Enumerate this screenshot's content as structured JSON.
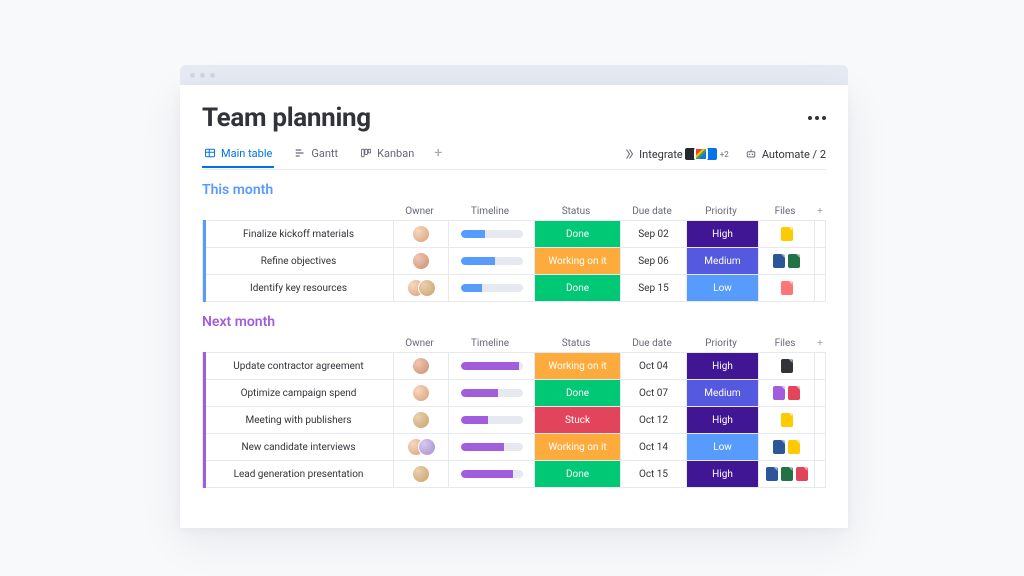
{
  "window": {
    "title": "Team planning"
  },
  "tabs": [
    {
      "label": "Main table",
      "icon": "table-icon",
      "active": true
    },
    {
      "label": "Gantt",
      "icon": "gantt-icon",
      "active": false
    },
    {
      "label": "Kanban",
      "icon": "kanban-icon",
      "active": false
    }
  ],
  "toolbar": {
    "integrate": {
      "label": "Integrate",
      "extra": "+2"
    },
    "automate": {
      "label": "Automate / 2"
    }
  },
  "columns": [
    "Owner",
    "Timeline",
    "Status",
    "Due date",
    "Priority",
    "Files"
  ],
  "status_colors": {
    "Done": "#00c875",
    "Working on it": "#fdab3d",
    "Stuck": "#e2445c"
  },
  "priority_colors": {
    "High": "#401694",
    "Medium": "#5559df",
    "Low": "#579bfc"
  },
  "file_colors": {
    "doc-yellow": "#ffcb00",
    "doc-word": "#2b579a",
    "doc-excel": "#217346",
    "doc-pink": "#ff7575",
    "doc-png": "#323338",
    "doc-purple": "#a25ddc",
    "doc-red": "#e2445c"
  },
  "groups": [
    {
      "name": "This month",
      "color": "#579bfc",
      "items": [
        {
          "name": "Finalize kickoff materials",
          "owners": [
            "a1"
          ],
          "progress": 40,
          "status": "Done",
          "due": "Sep 02",
          "priority": "High",
          "files": [
            "doc-yellow"
          ]
        },
        {
          "name": "Refine objectives",
          "owners": [
            "a2"
          ],
          "progress": 55,
          "status": "Working on it",
          "due": "Sep 06",
          "priority": "Medium",
          "files": [
            "doc-word",
            "doc-excel"
          ]
        },
        {
          "name": "Identify key resources",
          "owners": [
            "a1",
            "a3"
          ],
          "progress": 35,
          "status": "Done",
          "due": "Sep 15",
          "priority": "Low",
          "files": [
            "doc-pink"
          ]
        }
      ]
    },
    {
      "name": "Next month",
      "color": "#a25ddc",
      "items": [
        {
          "name": "Update contractor agreement",
          "owners": [
            "a2"
          ],
          "progress": 95,
          "status": "Working on it",
          "due": "Oct 04",
          "priority": "High",
          "files": [
            "doc-png"
          ]
        },
        {
          "name": "Optimize campaign spend",
          "owners": [
            "a1"
          ],
          "progress": 60,
          "status": "Done",
          "due": "Oct 07",
          "priority": "Medium",
          "files": [
            "doc-purple",
            "doc-red"
          ]
        },
        {
          "name": "Meeting with publishers",
          "owners": [
            "a3"
          ],
          "progress": 45,
          "status": "Stuck",
          "due": "Oct 12",
          "priority": "High",
          "files": [
            "doc-yellow"
          ]
        },
        {
          "name": "New candidate interviews",
          "owners": [
            "a1",
            "a4"
          ],
          "progress": 70,
          "status": "Working on it",
          "due": "Oct 14",
          "priority": "Low",
          "files": [
            "doc-word",
            "doc-yellow"
          ]
        },
        {
          "name": "Lead generation presentation",
          "owners": [
            "a3"
          ],
          "progress": 85,
          "status": "Done",
          "due": "Oct 15",
          "priority": "High",
          "files": [
            "doc-word",
            "doc-excel",
            "doc-red"
          ]
        }
      ]
    }
  ]
}
